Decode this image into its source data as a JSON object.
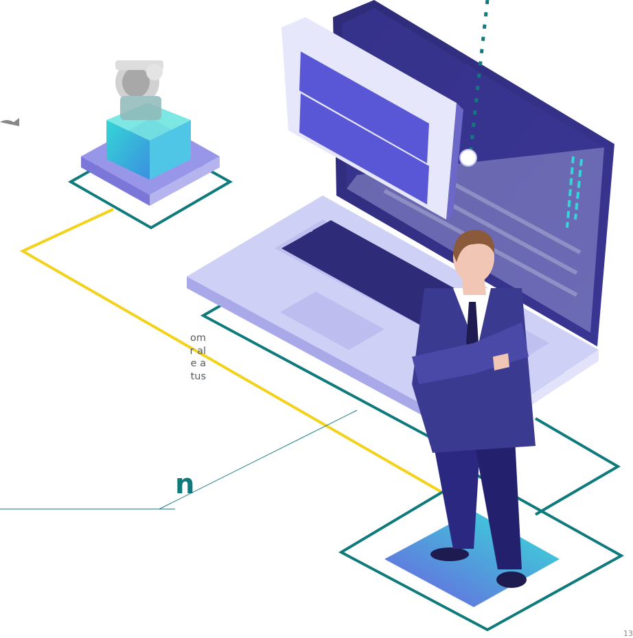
{
  "caption": {
    "lines": [
      "om",
      "r al",
      "e a",
      "tus"
    ]
  },
  "heading_fragment": "n",
  "page_number_fragment": "13",
  "colors": {
    "teal_line": "#0f7a7c",
    "yellow_line": "#f2d21b",
    "laptop_body": "#cfd0f5",
    "laptop_screen": "#2e2b78",
    "suit": "#3b3a91",
    "cyan_accent": "#35d6d9",
    "text_gray": "#555a5e"
  },
  "icons": {
    "pump": "pump-device-icon",
    "person": "businessman-illustration",
    "laptop": "laptop-illustration"
  }
}
